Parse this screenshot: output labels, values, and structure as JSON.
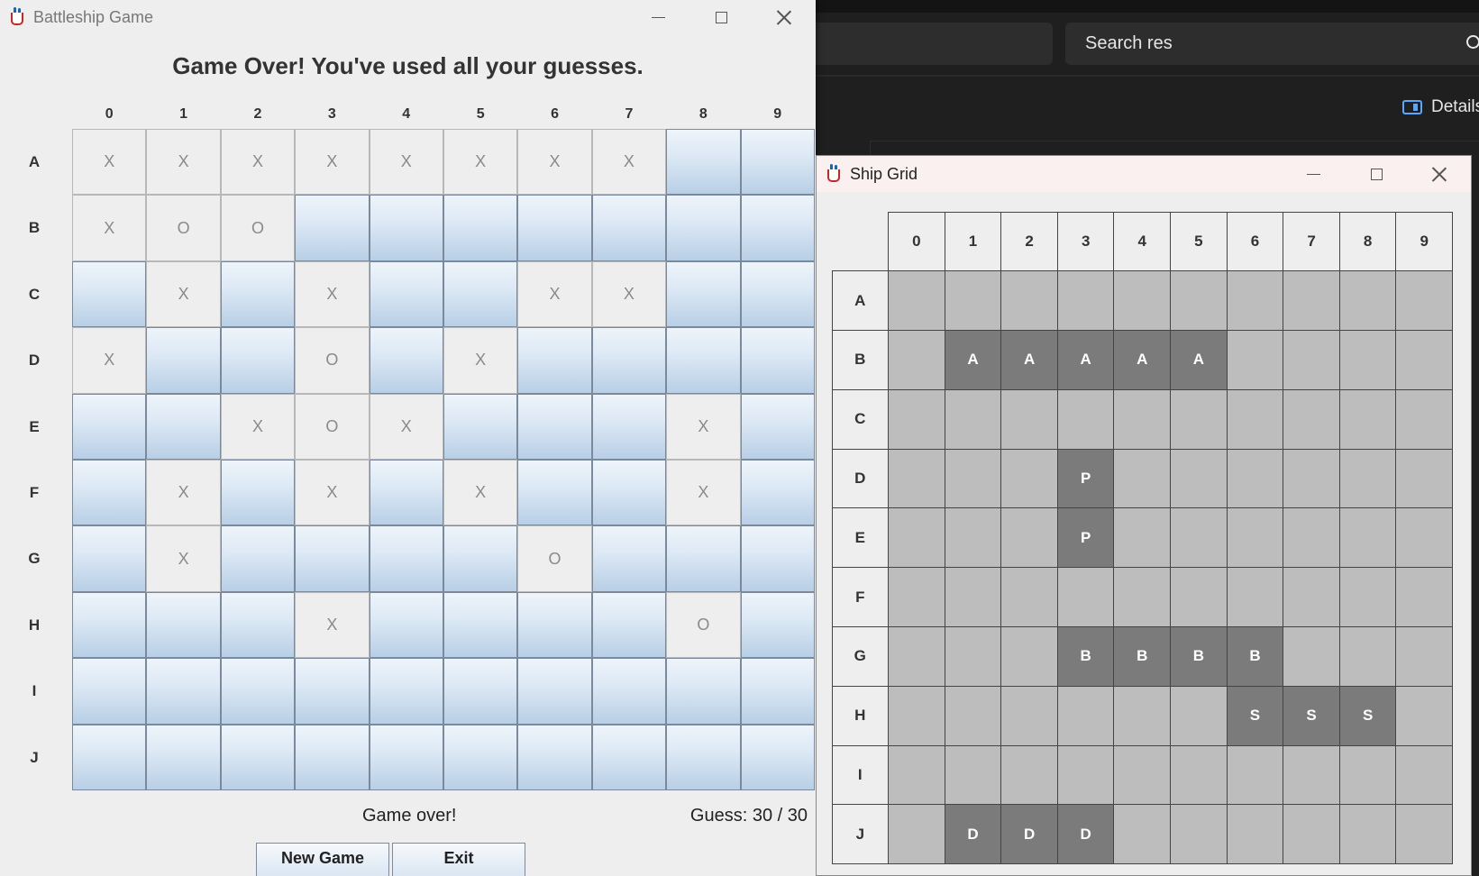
{
  "background_app": {
    "search_placeholder": "Search res",
    "details_label": "Details"
  },
  "battleship_window": {
    "title": "Battleship Game",
    "heading": "Game Over! You've used all your guesses.",
    "columns": [
      "0",
      "1",
      "2",
      "3",
      "4",
      "5",
      "6",
      "7",
      "8",
      "9"
    ],
    "rows": [
      "A",
      "B",
      "C",
      "D",
      "E",
      "F",
      "G",
      "H",
      "I",
      "J"
    ],
    "grid": [
      [
        "X",
        "X",
        "X",
        "X",
        "X",
        "X",
        "X",
        "X",
        "",
        ""
      ],
      [
        "X",
        "O",
        "O",
        "",
        "",
        "",
        "",
        "",
        "",
        ""
      ],
      [
        "",
        "X",
        "",
        "X",
        "",
        "",
        "X",
        "X",
        "",
        ""
      ],
      [
        "X",
        "",
        "",
        "O",
        "",
        "X",
        "",
        "",
        "",
        ""
      ],
      [
        "",
        "",
        "X",
        "O",
        "X",
        "",
        "",
        "",
        "X",
        ""
      ],
      [
        "",
        "X",
        "",
        "X",
        "",
        "X",
        "",
        "",
        "X",
        ""
      ],
      [
        "",
        "X",
        "",
        "",
        "",
        "",
        "O",
        "",
        "",
        ""
      ],
      [
        "",
        "",
        "",
        "X",
        "",
        "",
        "",
        "",
        "O",
        ""
      ],
      [
        "",
        "",
        "",
        "",
        "",
        "",
        "",
        "",
        "",
        ""
      ],
      [
        "",
        "",
        "",
        "",
        "",
        "",
        "",
        "",
        "",
        ""
      ]
    ],
    "status_text": "Game over!",
    "guess_text": "Guess: 30 / 30",
    "new_game_label": "New Game",
    "exit_label": "Exit"
  },
  "ship_grid_window": {
    "title": "Ship Grid",
    "columns": [
      "0",
      "1",
      "2",
      "3",
      "4",
      "5",
      "6",
      "7",
      "8",
      "9"
    ],
    "rows": [
      "A",
      "B",
      "C",
      "D",
      "E",
      "F",
      "G",
      "H",
      "I",
      "J"
    ],
    "grid": [
      [
        "",
        "",
        "",
        "",
        "",
        "",
        "",
        "",
        "",
        ""
      ],
      [
        "",
        "A",
        "A",
        "A",
        "A",
        "A",
        "",
        "",
        "",
        ""
      ],
      [
        "",
        "",
        "",
        "",
        "",
        "",
        "",
        "",
        "",
        ""
      ],
      [
        "",
        "",
        "",
        "P",
        "",
        "",
        "",
        "",
        "",
        ""
      ],
      [
        "",
        "",
        "",
        "P",
        "",
        "",
        "",
        "",
        "",
        ""
      ],
      [
        "",
        "",
        "",
        "",
        "",
        "",
        "",
        "",
        "",
        ""
      ],
      [
        "",
        "",
        "",
        "B",
        "B",
        "B",
        "B",
        "",
        "",
        ""
      ],
      [
        "",
        "",
        "",
        "",
        "",
        "",
        "S",
        "S",
        "S",
        ""
      ],
      [
        "",
        "",
        "",
        "",
        "",
        "",
        "",
        "",
        "",
        ""
      ],
      [
        "",
        "D",
        "D",
        "D",
        "",
        "",
        "",
        "",
        "",
        ""
      ]
    ]
  },
  "colors": {
    "water_top": "#eef4fa",
    "water_bottom": "#b8cfe6",
    "ship_cell": "#7b7b7b",
    "empty_cell": "#bdbdbd",
    "dark_bg": "#1f1f1f"
  }
}
